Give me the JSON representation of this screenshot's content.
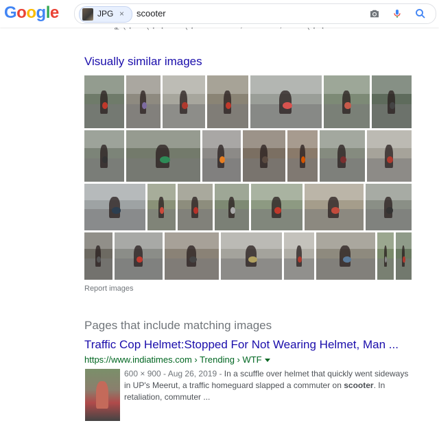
{
  "header": {
    "logo": [
      "G",
      "o",
      "o",
      "g",
      "l",
      "e"
    ],
    "image_chip_label": "JPG",
    "image_chip_close": "×",
    "query": "scooter"
  },
  "cut_text": "ଠ୦ୀ ୮ ଏକୁମ୍ୟ. ଅଧ୍ୟାୟ ଆଜ୍ଞାନ୍ୟ ୮ ଏକ ୦୦୦୦, ୭୦୦୦୦୦, ୦୯ ଅଧ୍ୟାୟ ...",
  "visually_similar": {
    "title": "Visually similar images",
    "tiles": [
      {
        "r": 0,
        "c": 0,
        "color": "#6f7b6a",
        "accent": "#c0392b"
      },
      {
        "r": 0,
        "c": 1,
        "color": "#8e8a80",
        "accent": "#7d6ba0"
      },
      {
        "r": 0,
        "c": 2,
        "color": "#a7a69d",
        "accent": "#b03a2e"
      },
      {
        "r": 0,
        "c": 3,
        "color": "#8a8475",
        "accent": "#c0392b"
      },
      {
        "r": 0,
        "c": 4,
        "color": "#9a9e98",
        "accent": "#d9534f"
      },
      {
        "r": 0,
        "c": 5,
        "color": "#7d8a76",
        "accent": "#c75a4a"
      },
      {
        "r": 0,
        "c": 6,
        "color": "#5e6b5c",
        "accent": "#444444"
      },
      {
        "r": 1,
        "c": 0,
        "color": "#7c8478",
        "accent": "#333333"
      },
      {
        "r": 1,
        "c": 1,
        "color": "#737a6b",
        "accent": "#2e8b57"
      },
      {
        "r": 1,
        "c": 2,
        "color": "#8c8a87",
        "accent": "#e67e22"
      },
      {
        "r": 1,
        "c": 3,
        "color": "#7b6f62",
        "accent": "#5a4a40"
      },
      {
        "r": 1,
        "c": 4,
        "color": "#8a7a6a",
        "accent": "#d35400"
      },
      {
        "r": 1,
        "c": 5,
        "color": "#858b7f",
        "accent": "#7a2e2e"
      },
      {
        "r": 1,
        "c": 6,
        "color": "#a6a39a",
        "accent": "#b03a2e"
      },
      {
        "r": 2,
        "c": 0,
        "color": "#9ea3a4",
        "accent": "#2c3e50"
      },
      {
        "r": 2,
        "c": 1,
        "color": "#8a9278",
        "accent": "#cc4a3a"
      },
      {
        "r": 2,
        "c": 2,
        "color": "#8d8d7d",
        "accent": "#b6332a"
      },
      {
        "r": 2,
        "c": 3,
        "color": "#7e8a73",
        "accent": "#aaaaaa"
      },
      {
        "r": 2,
        "c": 4,
        "color": "#8d9a82",
        "accent": "#c0392b"
      },
      {
        "r": 2,
        "c": 5,
        "color": "#a59d8b",
        "accent": "#c24b3c"
      },
      {
        "r": 2,
        "c": 6,
        "color": "#8a8f86",
        "accent": "#333333"
      },
      {
        "r": 3,
        "c": 0,
        "color": "#6d6a62",
        "accent": "#555555"
      },
      {
        "r": 3,
        "c": 1,
        "color": "#8b8d88",
        "accent": "#c23b2f"
      },
      {
        "r": 3,
        "c": 2,
        "color": "#8a8276",
        "accent": "#444444"
      },
      {
        "r": 3,
        "c": 3,
        "color": "#a4a39c",
        "accent": "#b0a060"
      },
      {
        "r": 3,
        "c": 4,
        "color": "#b0aea6",
        "accent": "#b03a2e"
      },
      {
        "r": 3,
        "c": 5,
        "color": "#8e8a7e",
        "accent": "#5a7a9a"
      },
      {
        "r": 3,
        "c": 6,
        "color": "#7a8a6a",
        "accent": "#888888"
      },
      {
        "r": 3,
        "c": 7,
        "color": "#6a7a62",
        "accent": "#b03a2e"
      }
    ]
  },
  "report_images": "Report images",
  "pages_matching": {
    "title": "Pages that include matching images",
    "result": {
      "title": "Traffic Cop Helmet:Stopped For Not Wearing Helmet, Man ...",
      "url": "https://www.indiatimes.com › Trending › WTF",
      "meta": "600 × 900 - Aug 26, 2019 - ",
      "snippet_before": "In a scuffle over helmet that quickly went sideways in UP's Meerut, a traffic homeguard slapped a commuter on ",
      "snippet_bold": "scooter",
      "snippet_after": ". In retaliation, commuter ..."
    }
  }
}
